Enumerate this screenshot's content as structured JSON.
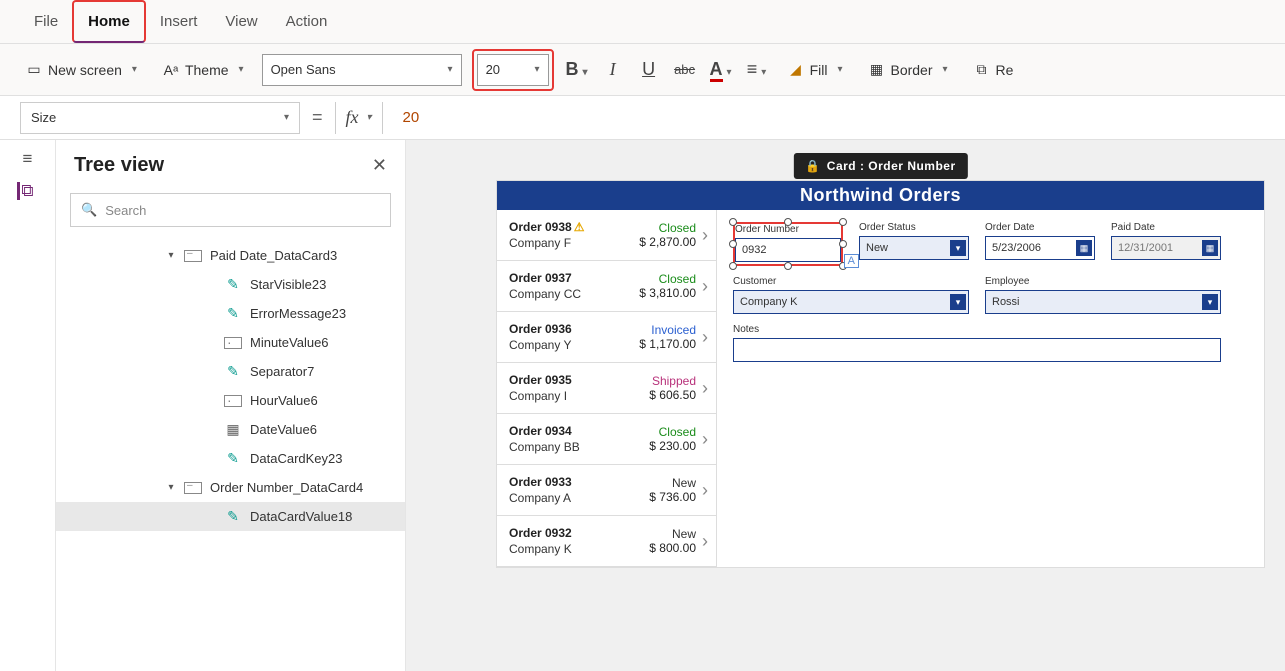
{
  "menu": {
    "file": "File",
    "home": "Home",
    "insert": "Insert",
    "view": "View",
    "action": "Action"
  },
  "toolbar": {
    "newScreen": "New screen",
    "theme": "Theme",
    "font": "Open Sans",
    "fontSize": "20",
    "fill": "Fill",
    "border": "Border",
    "re": "Re"
  },
  "formula": {
    "property": "Size",
    "value": "20"
  },
  "tree": {
    "title": "Tree view",
    "searchPlaceholder": "Search",
    "nodes": [
      {
        "lvl": 1,
        "type": "card",
        "caret": "▾",
        "label": "Paid Date_DataCard3"
      },
      {
        "lvl": 2,
        "type": "pencil",
        "label": "StarVisible23"
      },
      {
        "lvl": 2,
        "type": "pencil",
        "label": "ErrorMessage23"
      },
      {
        "lvl": 2,
        "type": "box",
        "label": "MinuteValue6"
      },
      {
        "lvl": 2,
        "type": "pencil",
        "label": "Separator7"
      },
      {
        "lvl": 2,
        "type": "box",
        "label": "HourValue6"
      },
      {
        "lvl": 2,
        "type": "cal",
        "label": "DateValue6"
      },
      {
        "lvl": 2,
        "type": "pencil",
        "label": "DataCardKey23"
      },
      {
        "lvl": 1,
        "type": "card",
        "caret": "▾",
        "label": "Order Number_DataCard4"
      },
      {
        "lvl": 2,
        "type": "pencil",
        "label": "DataCardValue18",
        "selected": true
      }
    ]
  },
  "canvas": {
    "tooltip": "Card : Order Number",
    "banner": "Northwind Orders",
    "orders": [
      {
        "id": "Order 0938",
        "warn": true,
        "company": "Company F",
        "status": "Closed",
        "statusCls": "s-closed",
        "amount": "$ 2,870.00"
      },
      {
        "id": "Order 0937",
        "company": "Company CC",
        "status": "Closed",
        "statusCls": "s-closed",
        "amount": "$ 3,810.00"
      },
      {
        "id": "Order 0936",
        "company": "Company Y",
        "status": "Invoiced",
        "statusCls": "s-invoiced",
        "amount": "$ 1,170.00"
      },
      {
        "id": "Order 0935",
        "company": "Company I",
        "status": "Shipped",
        "statusCls": "s-shipped",
        "amount": "$ 606.50"
      },
      {
        "id": "Order 0934",
        "company": "Company BB",
        "status": "Closed",
        "statusCls": "s-closed",
        "amount": "$ 230.00"
      },
      {
        "id": "Order 0933",
        "company": "Company A",
        "status": "New",
        "statusCls": "s-new",
        "amount": "$ 736.00"
      },
      {
        "id": "Order 0932",
        "company": "Company K",
        "status": "New",
        "statusCls": "s-new",
        "amount": "$ 800.00"
      }
    ],
    "form": {
      "orderNumber": {
        "label": "Order Number",
        "value": "0932"
      },
      "orderStatus": {
        "label": "Order Status",
        "value": "New"
      },
      "orderDate": {
        "label": "Order Date",
        "value": "5/23/2006"
      },
      "paidDate": {
        "label": "Paid Date",
        "value": "12/31/2001"
      },
      "customer": {
        "label": "Customer",
        "value": "Company K"
      },
      "employee": {
        "label": "Employee",
        "value": "Rossi"
      },
      "notes": {
        "label": "Notes",
        "value": ""
      }
    }
  }
}
